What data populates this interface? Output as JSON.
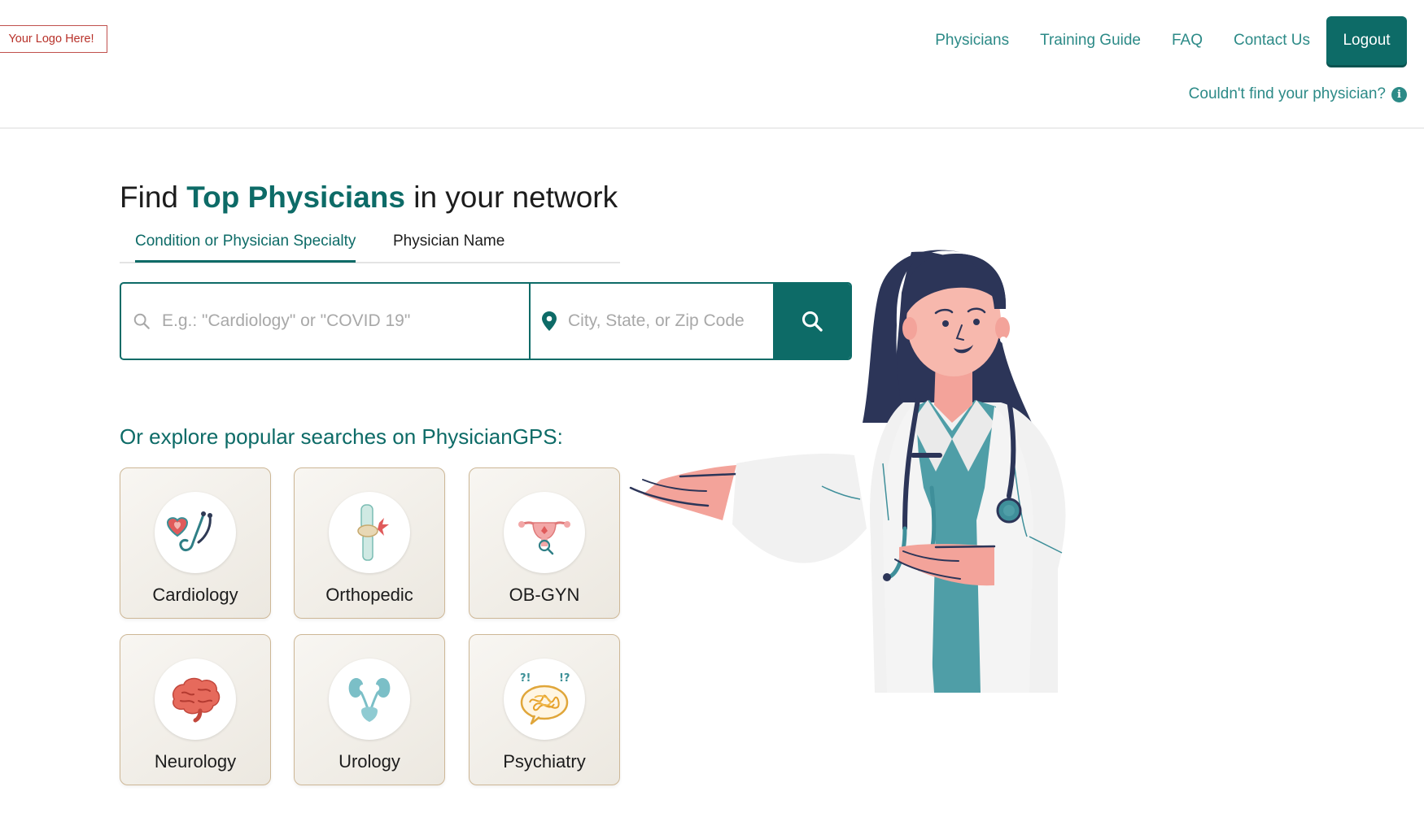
{
  "header": {
    "logo_text": "Your Logo Here!",
    "nav": [
      "Physicians",
      "Training Guide",
      "FAQ",
      "Contact Us"
    ],
    "logout_label": "Logout",
    "cant_find_text": "Couldn't find your physician?",
    "info_icon": "i"
  },
  "hero": {
    "headline_prefix": "Find",
    "headline_accent": "Top Physicians",
    "headline_suffix": "in your network",
    "tabs": [
      "Condition or Physician Specialty",
      "Physician Name"
    ],
    "active_tab": "Condition or Physician Specialty"
  },
  "search": {
    "condition_placeholder": "E.g.: \"Cardiology\" or \"COVID 19\"",
    "location_placeholder": "City, State, or Zip Code",
    "icons": [
      "search-icon",
      "location-pin-icon",
      "search-icon"
    ]
  },
  "explore": {
    "heading": "Or explore popular searches on PhysicianGPS:",
    "specialties": [
      {
        "label": "Cardiology",
        "icon": "heart-stethoscope-icon"
      },
      {
        "label": "Orthopedic",
        "icon": "knee-joint-icon"
      },
      {
        "label": "OB-GYN",
        "icon": "uterus-icon"
      },
      {
        "label": "Neurology",
        "icon": "brain-icon"
      },
      {
        "label": "Urology",
        "icon": "kidneys-icon"
      },
      {
        "label": "Psychiatry",
        "icon": "tangled-thoughts-icon"
      }
    ]
  },
  "colors": {
    "brand": "#0d6b67",
    "link": "#2c8a87",
    "logo_red": "#b8322a",
    "card_border": "#cdb796"
  }
}
